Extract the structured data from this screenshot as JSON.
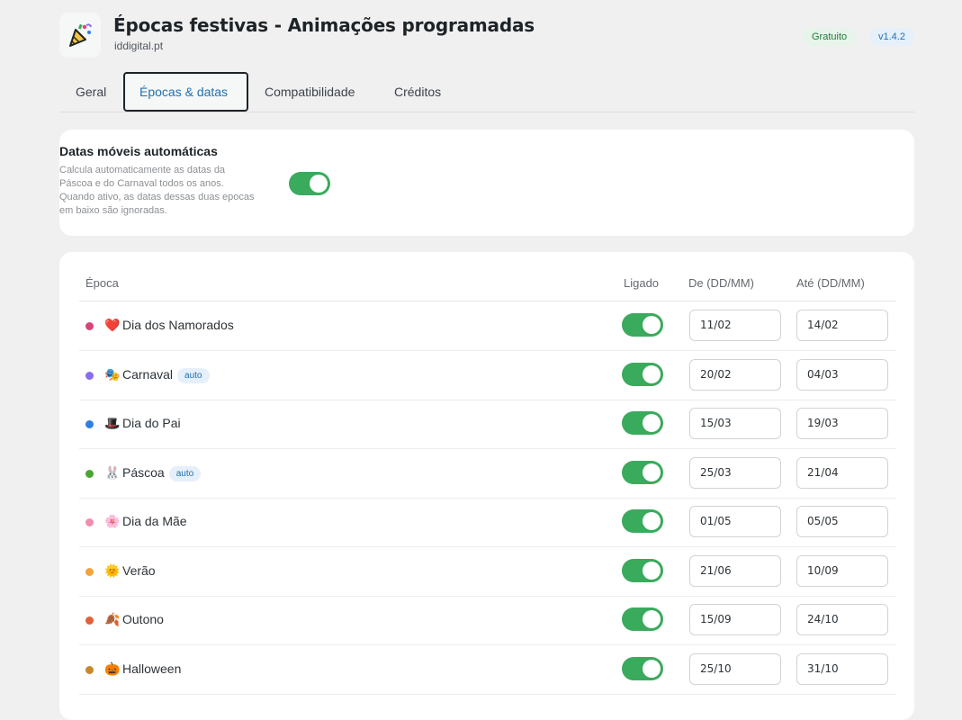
{
  "app": {
    "icon": "party-popper-icon",
    "title": "Épocas festivas - Animações programadas",
    "domain": "iddigital.pt",
    "badge_free": "Gratuito",
    "version": "v1.4.2"
  },
  "tabs": [
    {
      "label": "Geral",
      "active": false
    },
    {
      "label": "Épocas & datas",
      "active": true
    },
    {
      "label": "Compatibilidade",
      "active": false
    },
    {
      "label": "Créditos",
      "active": false
    }
  ],
  "auto_dates": {
    "title": "Datas móveis automáticas",
    "description": "Calcula automaticamente as datas da Páscoa e do Carnaval todos os anos. Quando ativo, as datas dessas duas epocas em baixo são ignoradas.",
    "enabled": true
  },
  "table": {
    "headers": {
      "season": "Época",
      "enabled": "Ligado",
      "from": "De (DD/MM)",
      "to": "Até (DD/MM)"
    },
    "rows": [
      {
        "name": "Dia dos Namorados",
        "emoji": "❤️",
        "icon": "heart-icon",
        "dot_color": "#d6457a",
        "auto": "",
        "enabled": true,
        "from": "11/02",
        "to": "14/02"
      },
      {
        "name": "Carnaval",
        "emoji": "🎭",
        "icon": "carnival-masks-icon",
        "dot_color": "#8b6cf0",
        "auto": "auto",
        "enabled": true,
        "from": "20/02",
        "to": "04/03"
      },
      {
        "name": "Dia do Pai",
        "emoji": "🎩",
        "icon": "top-hat-icon",
        "dot_color": "#2f7fe0",
        "auto": "",
        "enabled": true,
        "from": "15/03",
        "to": "19/03"
      },
      {
        "name": "Páscoa",
        "emoji": "🐰",
        "icon": "bunny-icon",
        "dot_color": "#4ea336",
        "auto": "auto",
        "enabled": true,
        "from": "25/03",
        "to": "21/04"
      },
      {
        "name": "Dia da Mãe",
        "emoji": "🌸",
        "icon": "flower-icon",
        "dot_color": "#f08cb0",
        "auto": "",
        "enabled": true,
        "from": "01/05",
        "to": "05/05"
      },
      {
        "name": "Verão",
        "emoji": "🌞",
        "icon": "sun-icon",
        "dot_color": "#f2a43a",
        "auto": "",
        "enabled": true,
        "from": "21/06",
        "to": "10/09"
      },
      {
        "name": "Outono",
        "emoji": "🍂",
        "icon": "autumn-leaf-icon",
        "dot_color": "#e0603a",
        "auto": "",
        "enabled": true,
        "from": "15/09",
        "to": "24/10"
      },
      {
        "name": "Halloween",
        "emoji": "🎃",
        "icon": "pumpkin-icon",
        "dot_color": "#c7882a",
        "auto": "",
        "enabled": true,
        "from": "25/10",
        "to": "31/10"
      }
    ]
  }
}
